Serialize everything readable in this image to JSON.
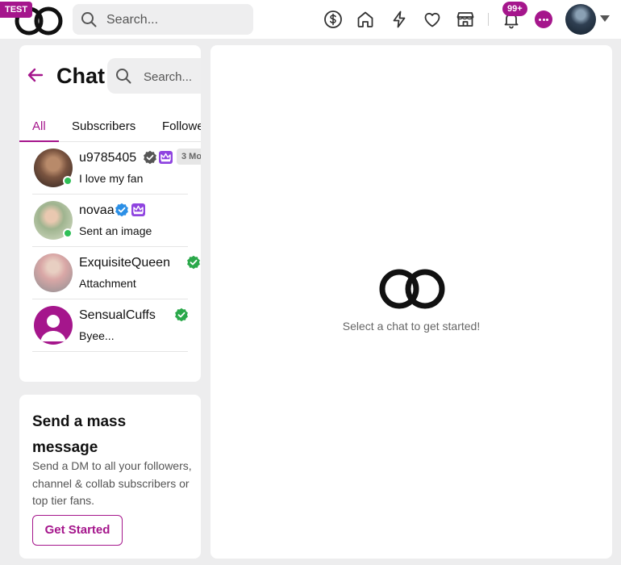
{
  "header": {
    "test_badge": "TEST",
    "search_placeholder": "Search...",
    "notification_count": "99+",
    "nav_icons": [
      "dollar-icon",
      "home-icon",
      "bolt-icon",
      "heart-icon",
      "store-icon",
      "bell-icon",
      "chat-bubble-icon"
    ]
  },
  "chat_panel": {
    "title": "Chat",
    "search_placeholder": "Search...",
    "tabs": [
      {
        "label": "All",
        "active": true
      },
      {
        "label": "Subscribers",
        "active": false
      },
      {
        "label": "Followers",
        "active": false
      }
    ],
    "conversations": [
      {
        "name": "u9785405",
        "preview": "I love my fan",
        "online": true,
        "verified": "gray",
        "crown": true,
        "badge": "3 Mo"
      },
      {
        "name": "novaa",
        "preview": "Sent an image",
        "online": true,
        "verified": "blue",
        "crown": true
      },
      {
        "name": "ExquisiteQueen",
        "preview": "Attachment",
        "online": false,
        "verified": "green",
        "crown": false
      },
      {
        "name": "SensualCuffs",
        "preview": "Byee...",
        "online": false,
        "verified": "green",
        "crown": false
      }
    ]
  },
  "mass_message": {
    "title": "Send a mass message",
    "description": "Send a DM to all your followers, channel & collab subscribers or top tier fans.",
    "button_label": "Get Started"
  },
  "empty_state": {
    "text": "Select a chat to get started!"
  },
  "colors": {
    "accent": "#a5168c",
    "online": "#2fbf57",
    "verified_green": "#2aa84a",
    "verified_blue": "#2b8fe6",
    "verified_gray": "#555555",
    "crown": "#8f44e0",
    "background": "#ededee"
  }
}
